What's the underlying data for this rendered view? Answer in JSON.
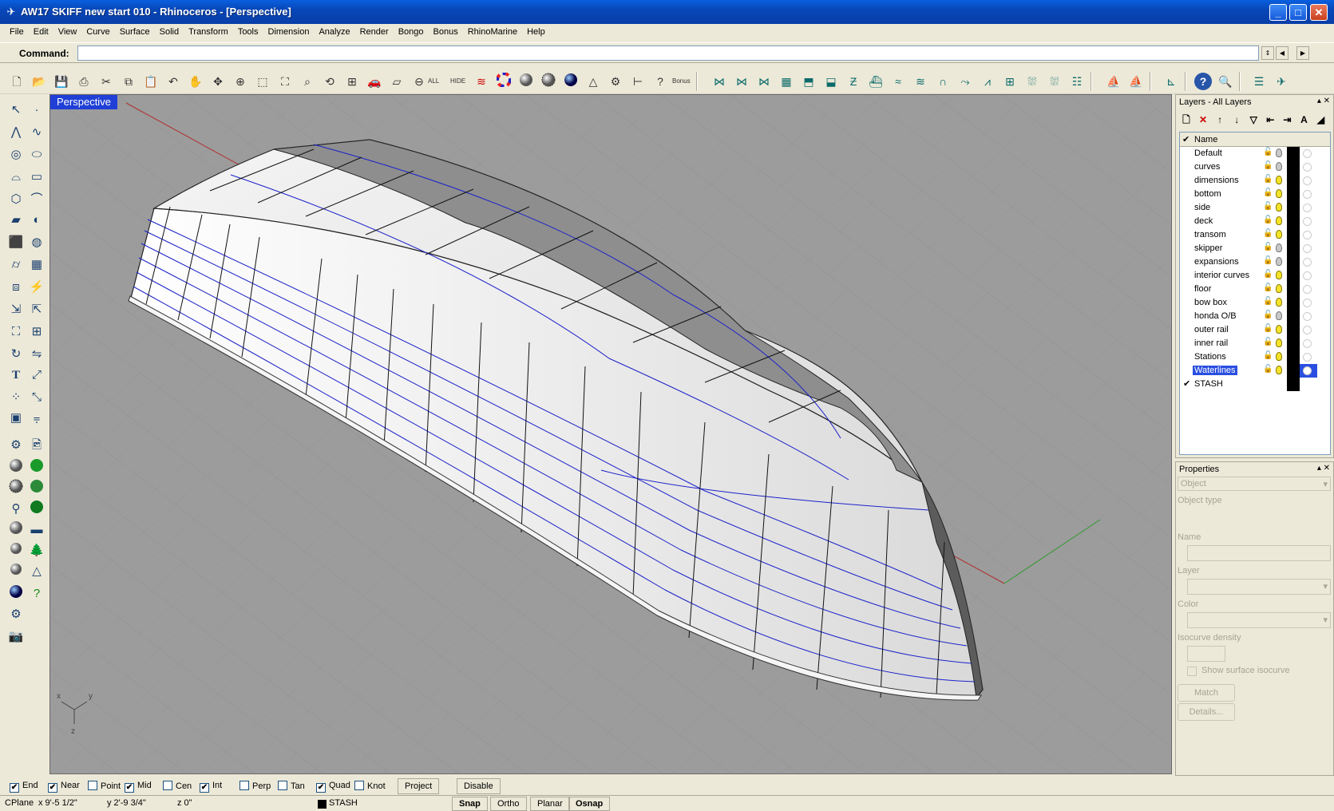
{
  "window": {
    "title": "AW17 SKIFF new start 010 - Rhinoceros - [Perspective]",
    "minimize": "_",
    "maximize": "□",
    "close": "✕"
  },
  "menu": [
    "File",
    "Edit",
    "View",
    "Curve",
    "Surface",
    "Solid",
    "Transform",
    "Tools",
    "Dimension",
    "Analyze",
    "Render",
    "Bongo",
    "Bonus",
    "RhinoMarine",
    "Help"
  ],
  "command": {
    "label": "Command:",
    "value": ""
  },
  "toolbar": {
    "all_label": "ALL",
    "hide_label": "HIDE",
    "bonus_label": "Bonus"
  },
  "viewport": {
    "label": "Perspective",
    "axis_x": "x",
    "axis_y": "y",
    "axis_z": "z"
  },
  "layers": {
    "title": "Layers - All Layers",
    "column_name": "Name",
    "items": [
      {
        "name": "Default",
        "bulb": "off",
        "checked": false
      },
      {
        "name": "curves",
        "bulb": "off",
        "checked": false
      },
      {
        "name": "dimensions",
        "bulb": "on",
        "checked": false
      },
      {
        "name": "bottom",
        "bulb": "on",
        "checked": false
      },
      {
        "name": "side",
        "bulb": "on",
        "checked": false
      },
      {
        "name": "deck",
        "bulb": "on",
        "checked": false
      },
      {
        "name": "transom",
        "bulb": "on",
        "checked": false
      },
      {
        "name": "skipper",
        "bulb": "off",
        "checked": false
      },
      {
        "name": "expansions",
        "bulb": "off",
        "checked": false
      },
      {
        "name": "interior curves",
        "bulb": "on",
        "checked": false
      },
      {
        "name": "floor",
        "bulb": "on",
        "checked": false
      },
      {
        "name": "bow box",
        "bulb": "on",
        "checked": false
      },
      {
        "name": "honda O/B",
        "bulb": "off",
        "checked": false
      },
      {
        "name": "outer rail",
        "bulb": "on",
        "checked": false
      },
      {
        "name": "inner rail",
        "bulb": "on",
        "checked": false
      },
      {
        "name": "Stations",
        "bulb": "on",
        "checked": false
      },
      {
        "name": "Waterlines",
        "bulb": "on",
        "checked": false,
        "selected": true
      },
      {
        "name": "STASH",
        "bulb": "",
        "checked": true
      }
    ]
  },
  "properties": {
    "title": "Properties",
    "select_value": "Object",
    "object_type_label": "Object type",
    "name_label": "Name",
    "layer_label": "Layer",
    "color_label": "Color",
    "isocurve_label": "Isocurve density",
    "show_isocurve_label": "Show surface isocurve",
    "match_label": "Match",
    "details_label": "Details..."
  },
  "osnap": {
    "items": [
      {
        "label": "End",
        "checked": true
      },
      {
        "label": "Near",
        "checked": true
      },
      {
        "label": "Point",
        "checked": false
      },
      {
        "label": "Mid",
        "checked": true
      },
      {
        "label": "Cen",
        "checked": false
      },
      {
        "label": "Int",
        "checked": true
      },
      {
        "label": "Perp",
        "checked": false
      },
      {
        "label": "Tan",
        "checked": false
      },
      {
        "label": "Quad",
        "checked": true
      },
      {
        "label": "Knot",
        "checked": false
      }
    ],
    "project_label": "Project",
    "disable_label": "Disable"
  },
  "status": {
    "cplane": "CPlane",
    "x": "x 9'-5 1/2\"",
    "y": "y 2'-9 3/4\"",
    "z": "z 0\"",
    "layer": "STASH",
    "snap": "Snap",
    "ortho": "Ortho",
    "planar": "Planar",
    "osnap": "Osnap"
  },
  "colors": {
    "title_bar": "#0a5fe0",
    "viewport_bg": "#9c9c9c",
    "viewport_label": "#1f3fd6",
    "waterline": "#1a20c8",
    "selection": "#2a4fe0"
  }
}
